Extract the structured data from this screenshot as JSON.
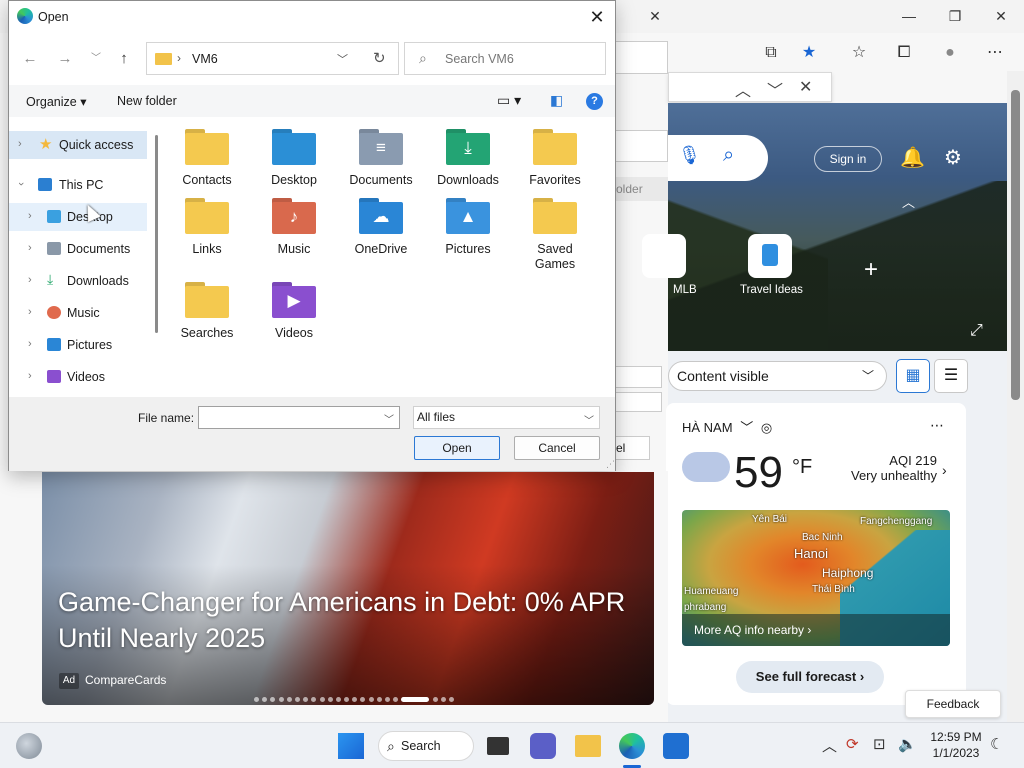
{
  "dialog": {
    "title": "Open",
    "path": {
      "segment": "VM6"
    },
    "search_placeholder": "Search VM6",
    "commands": {
      "organize": "Organize ▾",
      "new_folder": "New folder",
      "help": "?"
    },
    "nav": [
      {
        "label": "Quick access",
        "icon": "star-icon",
        "color": "#f3b83c"
      },
      {
        "label": "This PC",
        "icon": "monitor-icon",
        "color": "#2b7fd1"
      },
      {
        "label": "Desktop",
        "icon": "desktop-icon",
        "color": "#3aa0e0"
      },
      {
        "label": "Documents",
        "icon": "documents-icon",
        "color": "#8a98a8"
      },
      {
        "label": "Downloads",
        "icon": "downloads-icon",
        "color": "#2aa86e"
      },
      {
        "label": "Music",
        "icon": "music-icon",
        "color": "#e06a4d"
      },
      {
        "label": "Pictures",
        "icon": "pictures-icon",
        "color": "#2a86d6"
      },
      {
        "label": "Videos",
        "icon": "videos-icon",
        "color": "#8a4fcf"
      }
    ],
    "files": [
      {
        "label": "Contacts",
        "color": "#f4c94f",
        "glyph": ""
      },
      {
        "label": "Desktop",
        "color": "#2b8fd6",
        "glyph": ""
      },
      {
        "label": "Documents",
        "color": "#8a9bb0",
        "glyph": "≡"
      },
      {
        "label": "Downloads",
        "color": "#23a474",
        "glyph": "⤓"
      },
      {
        "label": "Favorites",
        "color": "#f4c94f",
        "glyph": ""
      },
      {
        "label": "Links",
        "color": "#f4c94f",
        "glyph": ""
      },
      {
        "label": "Music",
        "color": "#d9694d",
        "glyph": "♪"
      },
      {
        "label": "OneDrive",
        "color": "#2a86d6",
        "glyph": "☁"
      },
      {
        "label": "Pictures",
        "color": "#3a93de",
        "glyph": "▲"
      },
      {
        "label": "Saved Games",
        "color": "#f4c94f",
        "glyph": ""
      },
      {
        "label": "Searches",
        "color": "#f4c94f",
        "glyph": ""
      },
      {
        "label": "Videos",
        "color": "#8a4fcf",
        "glyph": "▶"
      }
    ],
    "file_name_label": "File name:",
    "file_name_value": "",
    "filter": "All files",
    "open_button": "Open",
    "cancel_button": "Cancel"
  },
  "browser": {
    "signin": "Sign in",
    "tiles": [
      {
        "label": "MLB"
      },
      {
        "label": "Travel Ideas"
      }
    ],
    "content_visible": "Content visible",
    "behind_text": {
      "folder": "older",
      "cancel": "el"
    }
  },
  "weather": {
    "location": "HÀ NAM",
    "temp": "59",
    "unit": "°F",
    "aqi": "AQI 219",
    "aqi_status": "Very unhealthy",
    "map_labels": [
      "Yên Bái",
      "Bac Ninh",
      "Fangchenggang",
      "Hanoi",
      "Haiphong",
      "Huameuang",
      "Thái Bình",
      "phrabang"
    ],
    "more_aq": "More AQ info nearby",
    "forecast": "See full forecast"
  },
  "feedback": "Feedback",
  "promo": {
    "title": "Game-Changer for Americans in Debt: 0% APR Until Nearly 2025",
    "ad": "Ad",
    "source": "CompareCards",
    "dots": 22,
    "active_dot": 18
  },
  "taskbar": {
    "search": "Search",
    "time": "12:59 PM",
    "date": "1/1/2023"
  }
}
